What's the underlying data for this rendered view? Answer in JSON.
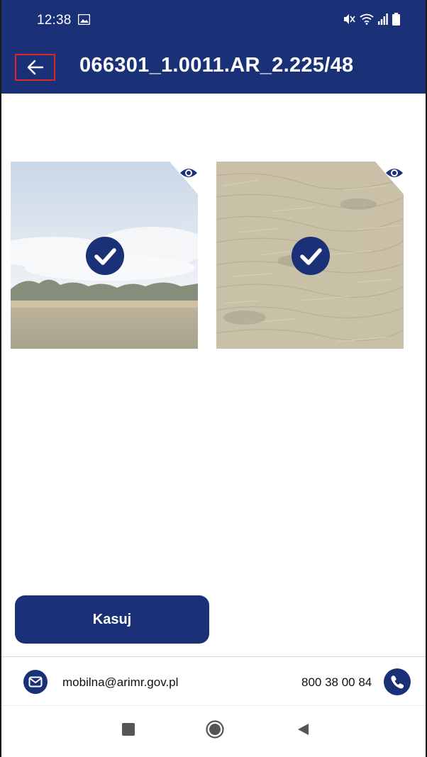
{
  "status_bar": {
    "time": "12:38",
    "icons": [
      "gallery-icon",
      "mute-icon",
      "wifi-icon",
      "signal-icon",
      "battery-icon"
    ]
  },
  "app_bar": {
    "title": "066301_1.0011.AR_2.225/48",
    "back_icon": "arrow-left-icon"
  },
  "photos": [
    {
      "scene": "field-with-sky",
      "selected": true,
      "preview_icon": "eye-icon"
    },
    {
      "scene": "dry-grass",
      "selected": true,
      "preview_icon": "eye-icon"
    }
  ],
  "actions": {
    "delete_label": "Kasuj"
  },
  "footer": {
    "email": "mobilna@arimr.gov.pl",
    "phone": "800 38 00 84"
  },
  "colors": {
    "primary": "#1a3178",
    "highlight": "#e02424",
    "background": "#ffffff"
  }
}
